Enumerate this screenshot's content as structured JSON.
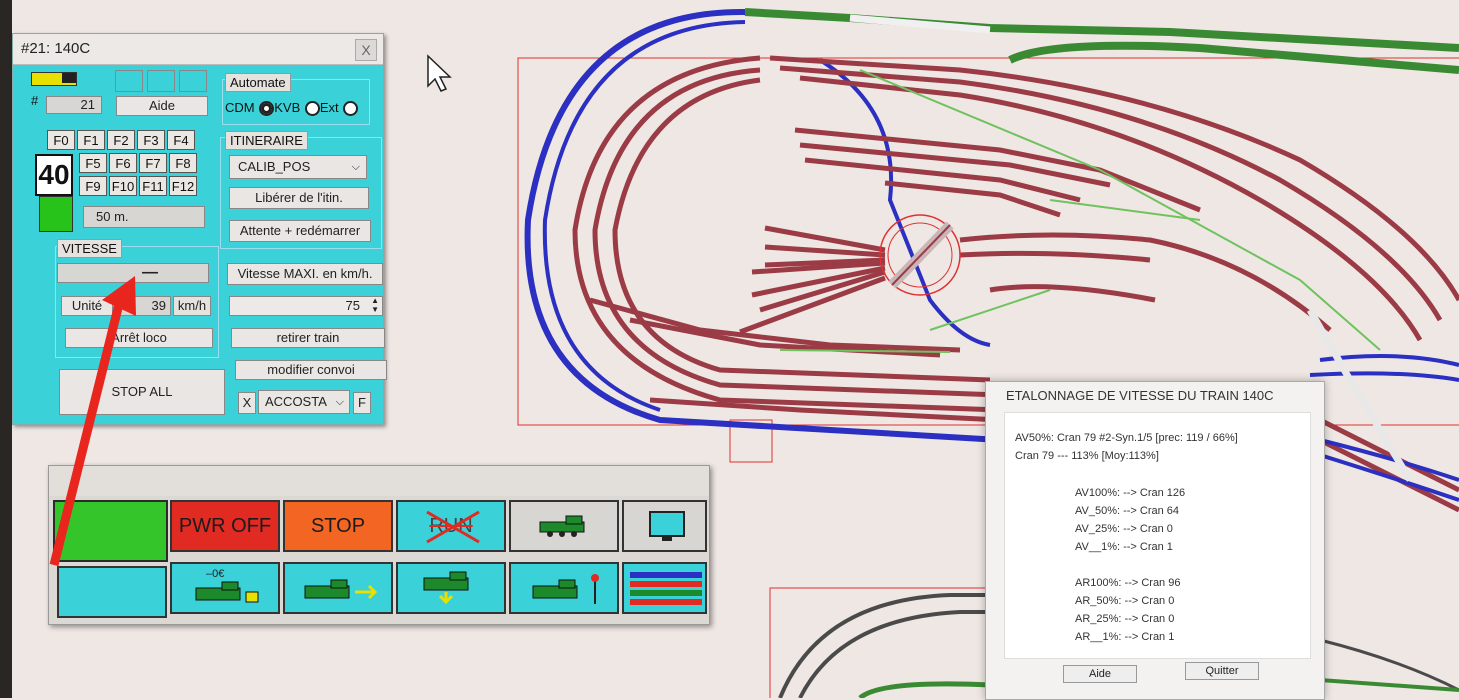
{
  "train_window": {
    "title": "#21: 140C",
    "close": "X",
    "hash": "#",
    "number": "21",
    "aide": "Aide",
    "function_keys": [
      "F0",
      "F1",
      "F2",
      "F3",
      "F4",
      "F5",
      "F6",
      "F7",
      "F8",
      "F9",
      "F10",
      "F11",
      "F12"
    ],
    "speed_limit_sign": "40",
    "distance": "50 m.",
    "vitesse_header": "VITESSE",
    "speed_value": "—",
    "unit_button": "Unité",
    "unit_value": "39",
    "unit_label": "km/h",
    "arret_loco": "Arrêt loco",
    "stop_all": "STOP ALL",
    "automate_header": "Automate",
    "automate_options": [
      "CDM",
      "KVB",
      "Ext"
    ],
    "automate_selected": "KVB",
    "itineraire_header": "ITINERAIRE",
    "itineraire_value": "CALIB_POS",
    "liberer": "Libérer de l'itin.",
    "attente": "Attente + redémarrer",
    "vitesse_maxi": "Vitesse MAXI. en km/h.",
    "max_speed": "75",
    "retirer": "retirer train",
    "modifier": "modifier convoi",
    "x_button": "X",
    "accosta": "ACCOSTA",
    "f_button": "F"
  },
  "control_panel": {
    "pwr_off": "PWR OFF",
    "stop": "STOP",
    "run": "RUN",
    "euro_label": "–0€"
  },
  "dialog": {
    "title": "ETALONNAGE DE VITESSE DU TRAIN 140C",
    "line1": "AV50%: Cran  79 #2-Syn.1/5 [prec: 119 /  66%]",
    "line2": "Cran 79 --- 113% [Moy:113%]",
    "av": [
      "AV100%: --> Cran  126",
      "AV_50%: --> Cran  64",
      "AV_25%: --> Cran   0",
      "AV__1%: --> Cran   1"
    ],
    "ar": [
      "AR100%: --> Cran  96",
      "AR_50%: --> Cran   0",
      "AR_25%: --> Cran   0",
      "AR__1%: --> Cran   1"
    ],
    "aide": "Aide",
    "quitter": "Quitter"
  },
  "colors": {
    "panel_cyan": "#3ad1d9",
    "track_red": "#9b3b45",
    "track_blue": "#2b2fc2",
    "track_green": "#3a8a34",
    "pwr_off_red": "#e02a22",
    "stop_orange": "#f26522",
    "arrow_red": "#e8261e"
  }
}
